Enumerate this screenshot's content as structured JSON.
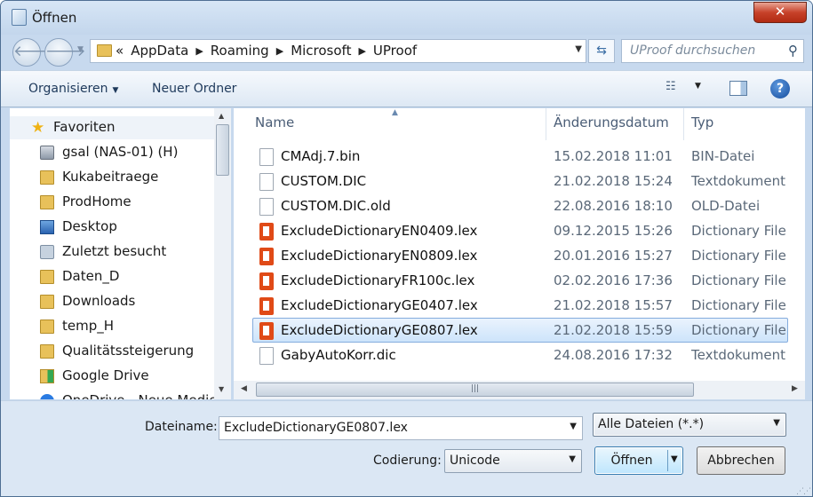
{
  "window": {
    "title": "Öffnen",
    "close_glyph": "✕"
  },
  "address": {
    "back_glyph": "🡐",
    "forward_glyph": "🡒",
    "crumb_prefix": "«",
    "crumbs": [
      "AppData",
      "Roaming",
      "Microsoft",
      "UProof"
    ],
    "search_placeholder": "UProof durchsuchen"
  },
  "toolbar": {
    "organize": "Organisieren",
    "new_folder": "Neuer Ordner"
  },
  "nav": {
    "items": [
      {
        "label": "Favoriten",
        "icon": "star-icon"
      },
      {
        "label": "gsal (NAS-01) (H)",
        "icon": "network-drive-icon"
      },
      {
        "label": "Kukabeitraege",
        "icon": "folder-icon"
      },
      {
        "label": "ProdHome",
        "icon": "folder-icon"
      },
      {
        "label": "Desktop",
        "icon": "desktop-icon"
      },
      {
        "label": "Zuletzt besucht",
        "icon": "recent-places-icon"
      },
      {
        "label": "Daten_D",
        "icon": "folder-icon"
      },
      {
        "label": "Downloads",
        "icon": "downloads-folder-icon"
      },
      {
        "label": "temp_H",
        "icon": "folder-icon"
      },
      {
        "label": "Qualitätssteigerung",
        "icon": "folder-icon"
      },
      {
        "label": "Google Drive",
        "icon": "google-drive-icon"
      },
      {
        "label": "OneDrive - Neue Medien",
        "icon": "onedrive-icon"
      }
    ]
  },
  "columns": {
    "name": "Name",
    "date": "Änderungsdatum",
    "type": "Typ"
  },
  "files": [
    {
      "name": "CMAdj.7.bin",
      "date": "15.02.2018 11:01",
      "type": "BIN-Datei",
      "icon": "doc"
    },
    {
      "name": "CUSTOM.DIC",
      "date": "21.02.2018 15:24",
      "type": "Textdokument",
      "icon": "doc"
    },
    {
      "name": "CUSTOM.DIC.old",
      "date": "22.08.2016 18:10",
      "type": "OLD-Datei",
      "icon": "doc"
    },
    {
      "name": "ExcludeDictionaryEN0409.lex",
      "date": "09.12.2015 15:26",
      "type": "Dictionary File",
      "icon": "office"
    },
    {
      "name": "ExcludeDictionaryEN0809.lex",
      "date": "20.01.2016 15:27",
      "type": "Dictionary File",
      "icon": "office"
    },
    {
      "name": "ExcludeDictionaryFR100c.lex",
      "date": "02.02.2016 17:36",
      "type": "Dictionary File",
      "icon": "office"
    },
    {
      "name": "ExcludeDictionaryGE0407.lex",
      "date": "21.02.2018 15:57",
      "type": "Dictionary File",
      "icon": "office"
    },
    {
      "name": "ExcludeDictionaryGE0807.lex",
      "date": "21.02.2018 15:59",
      "type": "Dictionary File",
      "icon": "office",
      "selected": true
    },
    {
      "name": "GabyAutoKorr.dic",
      "date": "24.08.2016 17:32",
      "type": "Textdokument",
      "icon": "doc"
    }
  ],
  "bottom": {
    "filename_label": "Dateiname:",
    "filename_value": "ExcludeDictionaryGE0807.lex",
    "filter_value": "Alle Dateien  (*.*)",
    "encoding_label": "Codierung:",
    "encoding_value": "Unicode",
    "open_button": "Öffnen",
    "cancel_button": "Abbrechen"
  }
}
